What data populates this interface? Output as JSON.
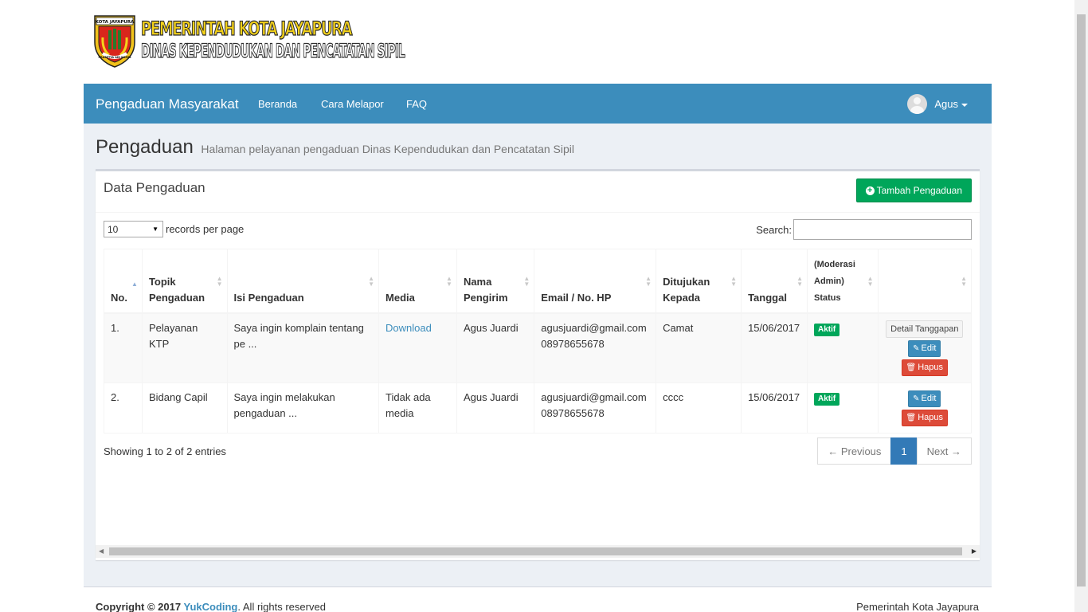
{
  "header": {
    "line1": "PEMERINTAH KOTA JAYAPURA",
    "line2": "DINAS KEPENDUDUKAN DAN PENCATATAN SIPIL",
    "seal_text_top": "KOTA JAYAPURA",
    "seal_text_bottom": "PRASETYA ADI KARYA"
  },
  "navbar": {
    "brand": "Pengaduan Masyarakat",
    "links": [
      "Beranda",
      "Cara Melapor",
      "FAQ"
    ],
    "user": "Agus",
    "color": "#3c8dbc"
  },
  "page": {
    "title": "Pengaduan",
    "subtitle": "Halaman pelayanan pengaduan Dinas Kependudukan dan Pencatatan Sipil"
  },
  "box": {
    "title": "Data Pengaduan",
    "add_button": "Tambah Pengaduan",
    "length_value": "10",
    "length_suffix": "records per page",
    "search_label": "Search:",
    "search_value": ""
  },
  "table": {
    "headers": {
      "no": "No.",
      "topik_1": "Topik",
      "topik_2": "Pengaduan",
      "isi": "Isi Pengaduan",
      "media": "Media",
      "nama_1": "Nama",
      "nama_2": "Pengirim",
      "email": "Email / No. HP",
      "tujuan_1": "Ditujukan",
      "tujuan_2": "Kepada",
      "tanggal": "Tanggal",
      "status_1": "(Moderasi",
      "status_2": "Admin)",
      "status_3": "Status"
    },
    "rows": [
      {
        "no": "1.",
        "topik": "Pelayanan KTP",
        "isi": "Saya ingin komplain tentang pe ...",
        "media": "Download",
        "nama": "Agus Juardi",
        "email": "agusjuardi@gmail.com",
        "hp": "08978655678",
        "tujuan": "Camat",
        "tanggal": "15/06/2017",
        "status": "Aktif",
        "detail_btn": "Detail Tanggapan",
        "edit_btn": "Edit",
        "hapus_btn": "Hapus"
      },
      {
        "no": "2.",
        "topik": "Bidang Capil",
        "isi": "Saya ingin melakukan pengaduan ...",
        "media": "Tidak ada media",
        "nama": "Agus Juardi",
        "email": "agusjuardi@gmail.com",
        "hp": "08978655678",
        "tujuan": "cccc",
        "tanggal": "15/06/2017",
        "status": "Aktif",
        "edit_btn": "Edit",
        "hapus_btn": "Hapus"
      }
    ]
  },
  "footer_info": "Showing 1 to 2 of 2 entries",
  "pagination": {
    "previous": "← Previous",
    "current": "1",
    "next": "Next →"
  },
  "footer": {
    "copyright_prefix": "Copyright © 2017 ",
    "copyright_link": "YukCoding",
    "copyright_suffix": ". All rights reserved",
    "right": "Pemerintah Kota Jayapura"
  }
}
